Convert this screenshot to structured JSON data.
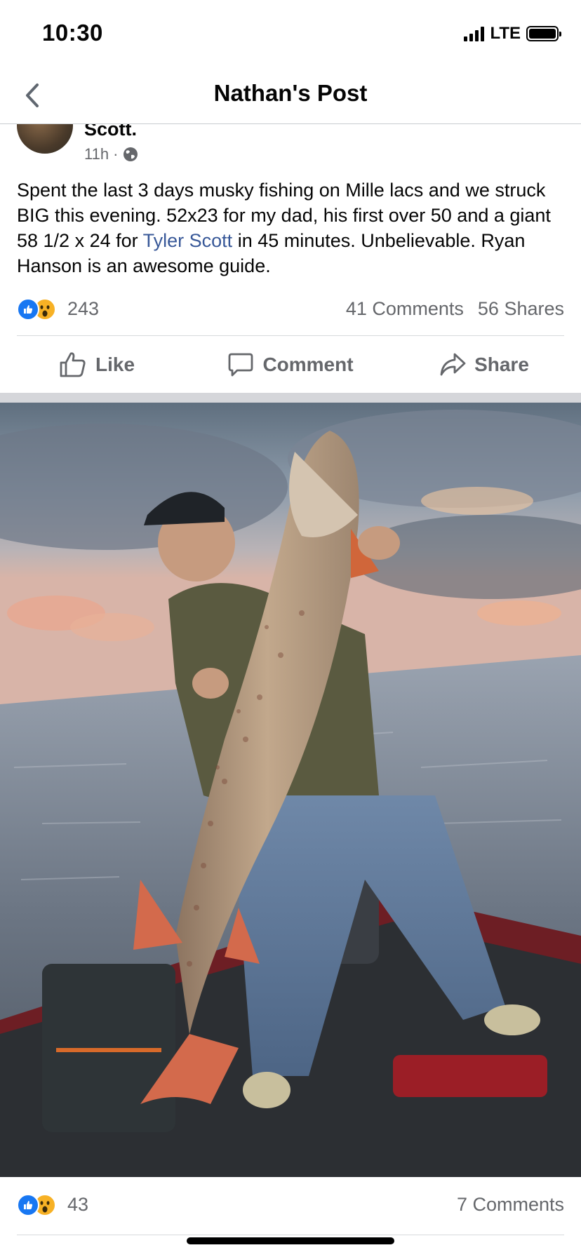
{
  "status_bar": {
    "time": "10:30",
    "network": "LTE"
  },
  "nav": {
    "title": "Nathan's Post"
  },
  "post": {
    "author_name": "Scott.",
    "time_ago": "11h",
    "separator": "·",
    "text_before": "Spent the last 3 days musky fishing on Mille lacs and we struck BIG this evening. 52x23 for my dad, his first over 50 and a giant 58 1/2 x 24 for ",
    "mention": "Tyler Scott",
    "text_after": " in 45 minutes. Unbelievable. Ryan Hanson is an awesome guide.",
    "reaction_count": "243",
    "comments": "41 Comments",
    "shares": "56 Shares",
    "actions": {
      "like": "Like",
      "comment": "Comment",
      "share": "Share"
    }
  },
  "photo_post": {
    "reaction_count": "43",
    "comments": "7 Comments"
  },
  "colors": {
    "link": "#385898",
    "like_blue": "#1877f2",
    "wow_yellow": "#f7b125",
    "muted": "#65676b"
  },
  "icons": [
    "back-chevron-icon",
    "globe-icon",
    "like-reaction-icon",
    "wow-reaction-icon",
    "thumbs-up-icon",
    "comment-bubble-icon",
    "share-arrow-icon"
  ]
}
